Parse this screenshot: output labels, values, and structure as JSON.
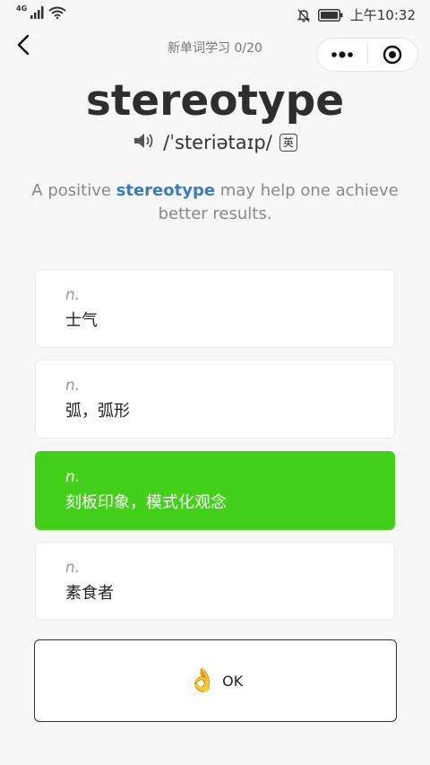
{
  "status": {
    "network": "4G",
    "time": "上午10:32"
  },
  "nav": {
    "title": "新单词学习 0/20"
  },
  "word": {
    "text": "stereotype",
    "phonetic": "/ˈsteriətaɪp/",
    "accent": "英"
  },
  "sentence": {
    "before": "A positive ",
    "highlight": "stereotype",
    "after": " may help one achieve better results."
  },
  "options": [
    {
      "pos": "n.",
      "meaning": "士气",
      "selected": false
    },
    {
      "pos": "n.",
      "meaning": "弧，弧形",
      "selected": false
    },
    {
      "pos": "n.",
      "meaning": "刻板印象，模式化观念",
      "selected": true
    },
    {
      "pos": "n.",
      "meaning": "素食者",
      "selected": false
    }
  ],
  "ok_button": {
    "emoji": "👌",
    "label": "OK"
  },
  "colors": {
    "selected": "#42d118",
    "highlight": "#3a7cc2"
  }
}
